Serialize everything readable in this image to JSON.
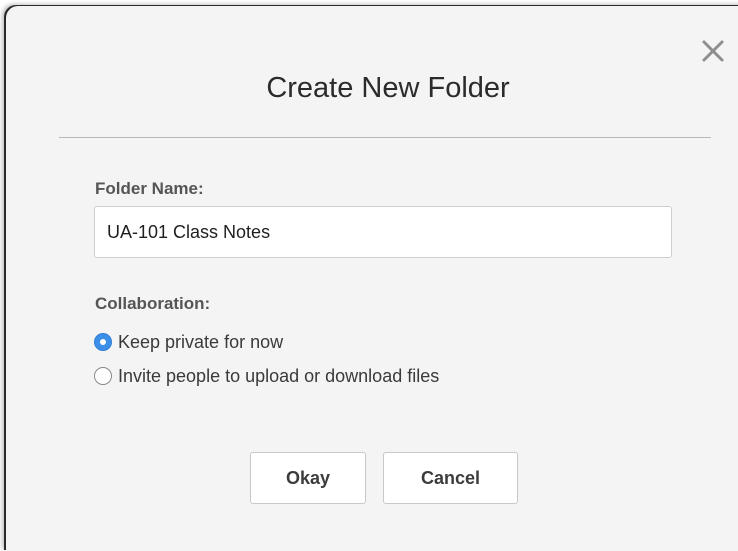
{
  "dialog": {
    "title": "Create New Folder",
    "close_icon": "close-icon",
    "folder_name": {
      "label": "Folder Name:",
      "value": "UA-101 Class Notes",
      "placeholder": ""
    },
    "collaboration": {
      "label": "Collaboration:",
      "options": [
        {
          "label": "Keep private for now",
          "selected": true
        },
        {
          "label": "Invite people to upload or download files",
          "selected": false
        }
      ]
    },
    "buttons": {
      "okay_label": "Okay",
      "cancel_label": "Cancel"
    },
    "colors": {
      "accent": "#3b8fe8",
      "dialog_background": "#f4f4f4",
      "divider": "#b9b9b9"
    }
  }
}
